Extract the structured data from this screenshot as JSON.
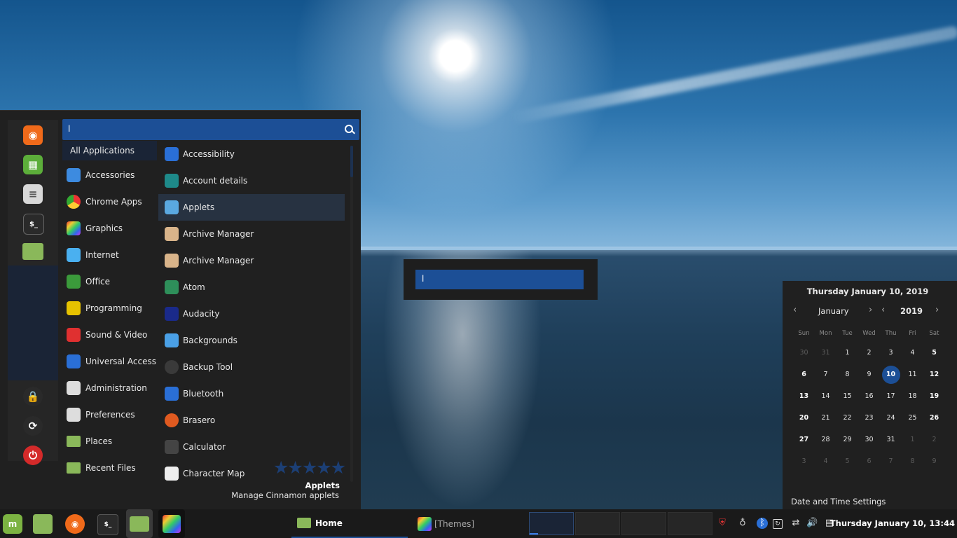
{
  "menu": {
    "search_value": "l",
    "categories": [
      {
        "label": "All Applications",
        "icon": "none",
        "color": ""
      },
      {
        "label": "Accessories",
        "icon": "scissors-icon",
        "color": "#3d8be0"
      },
      {
        "label": "Chrome Apps",
        "icon": "chrome-icon",
        "color": "#4a8af4"
      },
      {
        "label": "Graphics",
        "icon": "graphics-icon",
        "color": "#c23bd4"
      },
      {
        "label": "Internet",
        "icon": "cloud-icon",
        "color": "#4ab0f0"
      },
      {
        "label": "Office",
        "icon": "office-icon",
        "color": "#3b9a3b"
      },
      {
        "label": "Programming",
        "icon": "programming-icon",
        "color": "#e6c200"
      },
      {
        "label": "Sound & Video",
        "icon": "play-icon",
        "color": "#e03030"
      },
      {
        "label": "Universal Access",
        "icon": "accessibility-icon",
        "color": "#2a6fd6"
      },
      {
        "label": "Administration",
        "icon": "admin-icon",
        "color": "#dddddd"
      },
      {
        "label": "Preferences",
        "icon": "preferences-icon",
        "color": "#dddddd"
      },
      {
        "label": "Places",
        "icon": "folder-icon",
        "color": "#8ab85a"
      },
      {
        "label": "Recent Files",
        "icon": "recent-folder-icon",
        "color": "#8ab85a"
      }
    ],
    "apps": [
      {
        "label": "Accessibility",
        "icon": "accessibility-icon",
        "color": "#2a6fd6"
      },
      {
        "label": "Account details",
        "icon": "user-icon",
        "color": "#1e8a8a"
      },
      {
        "label": "Applets",
        "icon": "applets-icon",
        "color": "#5aa8e0"
      },
      {
        "label": "Archive Manager",
        "icon": "archive-icon",
        "color": "#d9b48a"
      },
      {
        "label": "Archive Manager",
        "icon": "archive-icon",
        "color": "#d9b48a"
      },
      {
        "label": "Atom",
        "icon": "atom-icon",
        "color": "#2e8f5a"
      },
      {
        "label": "Audacity",
        "icon": "audacity-icon",
        "color": "#1a2a8a"
      },
      {
        "label": "Backgrounds",
        "icon": "backgrounds-icon",
        "color": "#4aa0e6"
      },
      {
        "label": "Backup Tool",
        "icon": "backup-icon",
        "color": "#3a3a3a"
      },
      {
        "label": "Bluetooth",
        "icon": "bluetooth-icon",
        "color": "#2a6fd6"
      },
      {
        "label": "Brasero",
        "icon": "brasero-icon",
        "color": "#e05a20"
      },
      {
        "label": "Calculator",
        "icon": "calculator-icon",
        "color": "#444444"
      },
      {
        "label": "Character Map",
        "icon": "charmap-icon",
        "color": "#eeeeee"
      }
    ],
    "selected_index": 2,
    "stars": "★★★★★",
    "info_title": "Applets",
    "info_desc": "Manage Cinnamon applets",
    "favorites": [
      {
        "name": "firefox-icon",
        "color": "#f06a1a",
        "glyph": "◉"
      },
      {
        "name": "software-icon",
        "color": "#5cae3a",
        "glyph": "▦"
      },
      {
        "name": "settings-icon",
        "color": "#d8d8d8",
        "glyph": "≡"
      },
      {
        "name": "terminal-icon",
        "color": "#2a2a2a",
        "glyph": "$_"
      },
      {
        "name": "files-icon",
        "color": "#8ab85a",
        "glyph": ""
      }
    ],
    "session": [
      {
        "name": "lock-icon",
        "color": "#2a2a2a",
        "glyph": "🔒"
      },
      {
        "name": "logout-icon",
        "color": "#2a2a2a",
        "glyph": "⟳"
      },
      {
        "name": "power-icon",
        "color": "#d42a2a",
        "glyph": "⏻"
      }
    ]
  },
  "run_dialog": {
    "value": "l"
  },
  "calendar": {
    "full_date": "Thursday January 10, 2019",
    "month": "January",
    "year": "2019",
    "weekdays": [
      "Sun",
      "Mon",
      "Tue",
      "Wed",
      "Thu",
      "Fri",
      "Sat"
    ],
    "weeks": [
      [
        "30",
        "31",
        "1",
        "2",
        "3",
        "4",
        "5"
      ],
      [
        "6",
        "7",
        "8",
        "9",
        "10",
        "11",
        "12"
      ],
      [
        "13",
        "14",
        "15",
        "16",
        "17",
        "18",
        "19"
      ],
      [
        "20",
        "21",
        "22",
        "23",
        "24",
        "25",
        "26"
      ],
      [
        "27",
        "28",
        "29",
        "30",
        "31",
        "1",
        "2"
      ],
      [
        "3",
        "4",
        "5",
        "6",
        "7",
        "8",
        "9"
      ]
    ],
    "today": "10",
    "settings_label": "Date and Time Settings"
  },
  "panel": {
    "windows": [
      {
        "label": "Home",
        "icon": "folder-icon"
      },
      {
        "label": "[Themes]",
        "icon": "themes-icon"
      }
    ],
    "clock": "Thursday January 10, 13:44"
  }
}
